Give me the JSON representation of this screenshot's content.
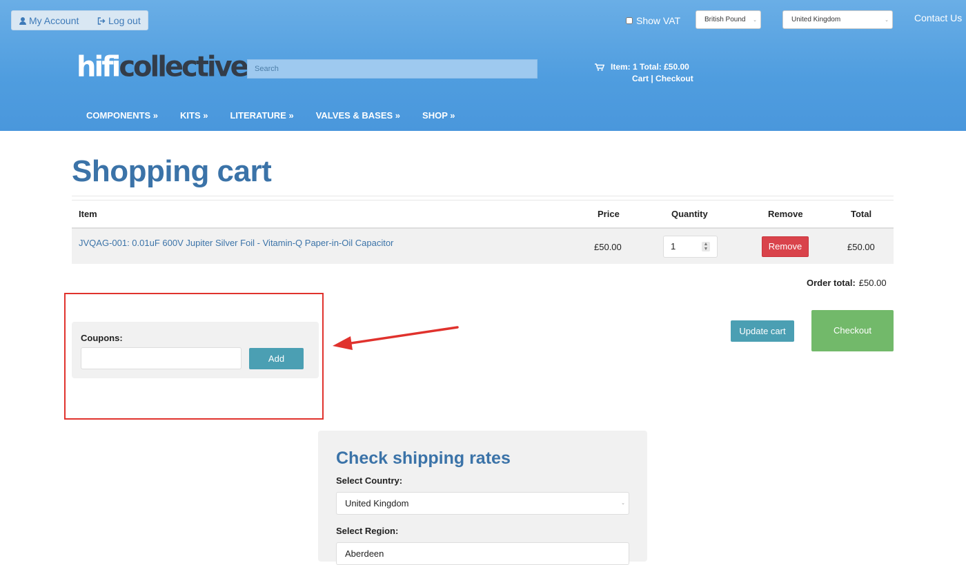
{
  "header": {
    "account": {
      "my_account": "My Account",
      "log_out": "Log out"
    },
    "show_vat": "Show VAT",
    "currency": "British Pound",
    "country": "United Kingdom",
    "contact": "Contact Us",
    "logo": {
      "part1": "hifi",
      "part2": "collective"
    },
    "search_placeholder": "Search",
    "cart": {
      "summary": "Item: 1 Total: £50.00",
      "links": "Cart | Checkout"
    },
    "nav": [
      "COMPONENTS »",
      "KITS »",
      "LITERATURE »",
      "VALVES & BASES »",
      "SHOP »"
    ]
  },
  "cart": {
    "title": "Shopping cart",
    "columns": {
      "item": "Item",
      "price": "Price",
      "quantity": "Quantity",
      "remove": "Remove",
      "total": "Total"
    },
    "rows": [
      {
        "item": "JVQAG-001: 0.01uF 600V Jupiter Silver Foil - Vitamin-Q Paper-in-Oil Capacitor",
        "price": "£50.00",
        "quantity": "1",
        "remove_label": "Remove",
        "total": "£50.00"
      }
    ],
    "order_total_label": "Order total:",
    "order_total": "£50.00",
    "update_label": "Update cart",
    "checkout_label": "Checkout"
  },
  "coupons": {
    "label": "Coupons:",
    "value": "",
    "add_label": "Add"
  },
  "shipping": {
    "title": "Check shipping rates",
    "country_label": "Select Country:",
    "country_value": "United Kingdom",
    "region_label": "Select Region:",
    "region_value": "Aberdeen"
  },
  "colors": {
    "header_blue": "#4f9ddf",
    "title_blue": "#3b73a8",
    "remove_red": "#d9434b",
    "teal": "#4b9fb3",
    "checkout_green": "#72b96a",
    "annotation_red": "#e0322d"
  }
}
